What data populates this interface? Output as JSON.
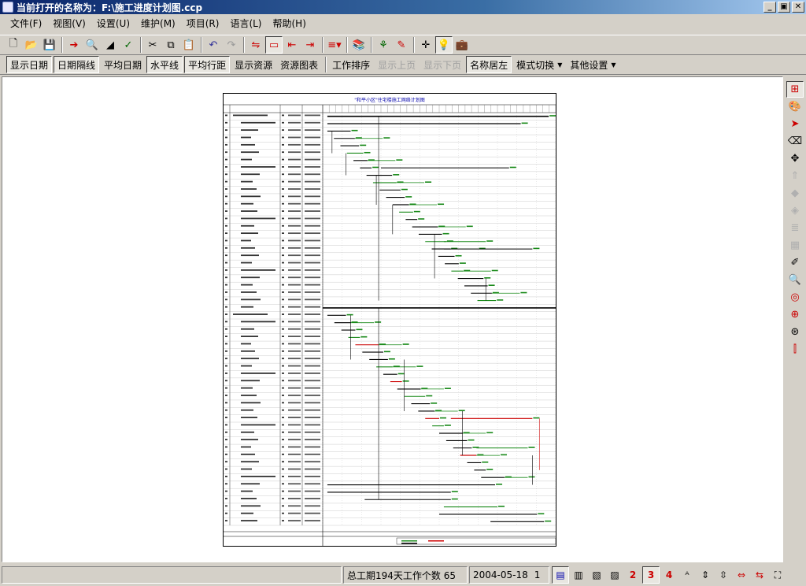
{
  "window": {
    "title": "当前打开的名称为：F:\\施工进度计划图.ccp",
    "buttons": [
      "_",
      "▣",
      "✕"
    ]
  },
  "menu": [
    "文件(F)",
    "视图(V)",
    "设置(U)",
    "维护(M)",
    "项目(R)",
    "语言(L)",
    "帮助(H)"
  ],
  "toolbar2": [
    {
      "label": "显示日期",
      "pressed": true
    },
    {
      "label": "日期隔线",
      "pressed": true
    },
    {
      "label": "平均日期",
      "pressed": false
    },
    {
      "label": "水平线",
      "pressed": true
    },
    {
      "label": "平均行距",
      "pressed": true
    },
    {
      "label": "显示资源",
      "pressed": false
    },
    {
      "label": "资源图表",
      "pressed": false
    },
    {
      "label": "工作排序",
      "pressed": false
    },
    {
      "label": "显示上页",
      "disabled": true
    },
    {
      "label": "显示下页",
      "disabled": true
    },
    {
      "label": "名称居左",
      "pressed": true
    },
    {
      "label": "模式切换",
      "dropdown": true
    },
    {
      "label": "其他设置",
      "dropdown": true
    }
  ],
  "chart": {
    "title": "\"和平小区\"住宅楼施工网络计划图",
    "row_count": 56
  },
  "status": {
    "summary": "总工期194天工作个数 65",
    "date": "2004-05-18",
    "page": "1",
    "numbers": [
      "2",
      "3",
      "4"
    ]
  },
  "colors": {
    "title_start": "#0a246a",
    "grid": "#999999",
    "bar_black": "#000000",
    "bar_green": "#1a8a1a",
    "bar_red": "#cc0000"
  }
}
